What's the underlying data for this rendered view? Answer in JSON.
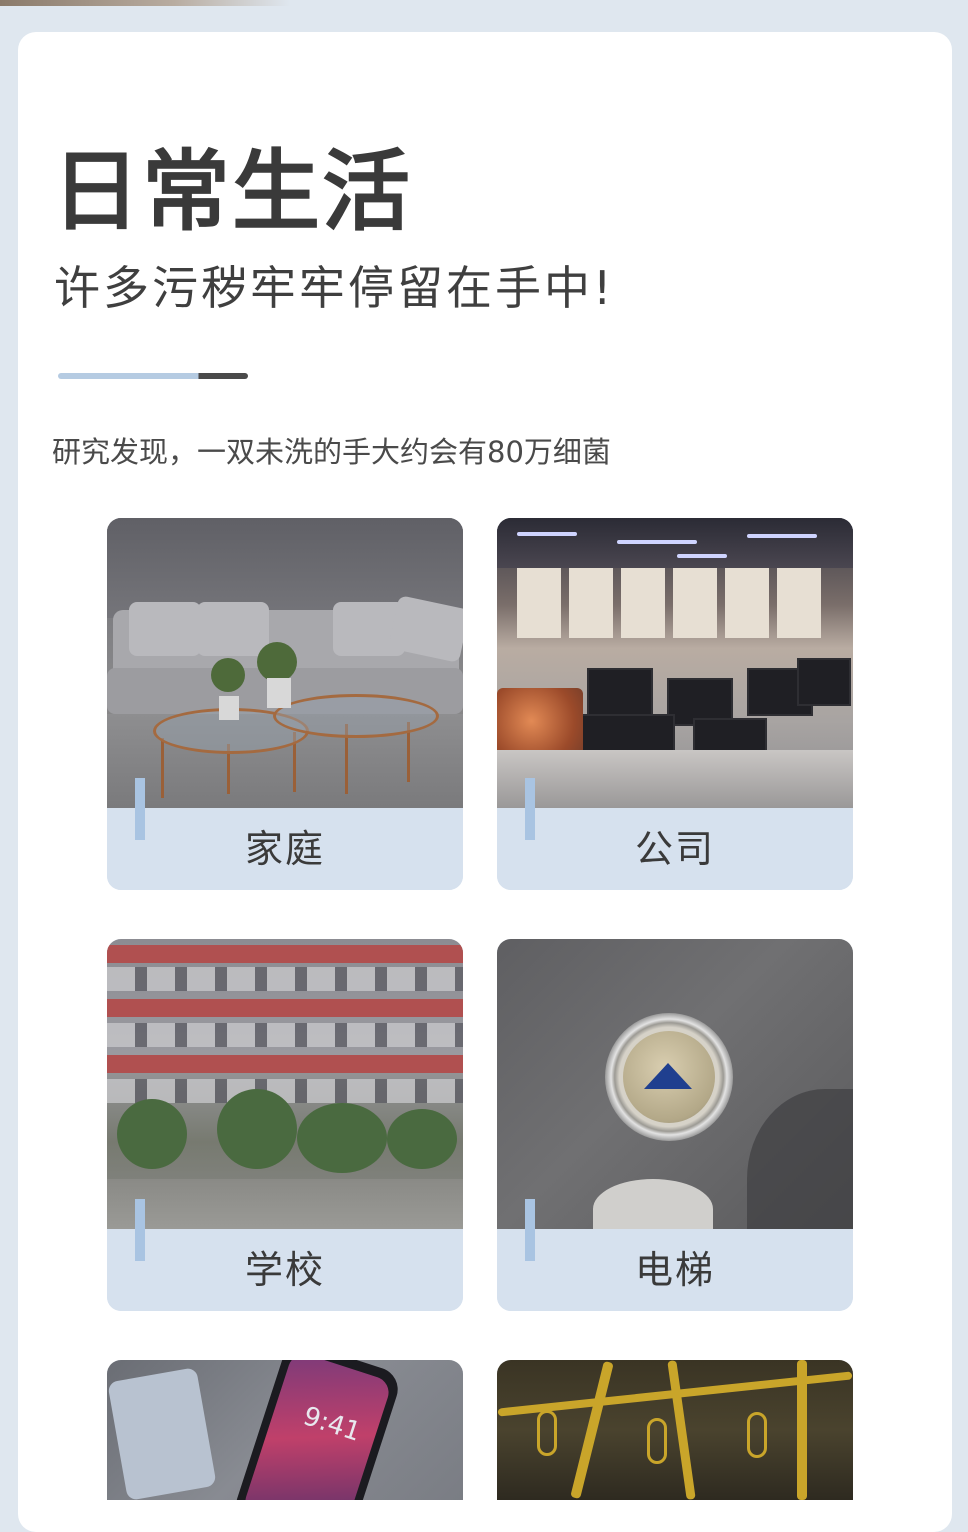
{
  "header": {
    "title": "日常生活",
    "subtitle": "许多污秽牢牢停留在手中!",
    "description": "研究发现，一双未洗的手大约会有80万细菌"
  },
  "colors": {
    "accent_blue": "#a9c4e2",
    "label_bg": "#d6e1ee",
    "text_dark": "#3a3a3a",
    "page_bg": "#dfe7ef"
  },
  "tiles": [
    {
      "label": "家庭",
      "icon": "sofa-photo"
    },
    {
      "label": "公司",
      "icon": "office-photo"
    },
    {
      "label": "学校",
      "icon": "school-building-photo"
    },
    {
      "label": "电梯",
      "icon": "elevator-button-photo"
    },
    {
      "label": "",
      "icon": "smartphone-photo",
      "time": "9:41"
    },
    {
      "label": "",
      "icon": "bus-handrail-photo"
    }
  ]
}
